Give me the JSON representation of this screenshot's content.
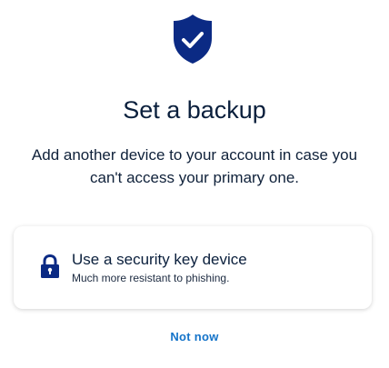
{
  "header": {
    "icon": "shield-check-icon",
    "title": "Set a backup",
    "description": "Add another device to your account in case you can't access your primary one."
  },
  "option": {
    "icon": "lock-icon",
    "title": "Use a security key device",
    "subtitle": "Much more resistant to phishing."
  },
  "actions": {
    "not_now_label": "Not now"
  },
  "colors": {
    "brand_navy": "#0b2a84",
    "text_dark": "#0a1f3c",
    "link_blue": "#1473c9"
  }
}
